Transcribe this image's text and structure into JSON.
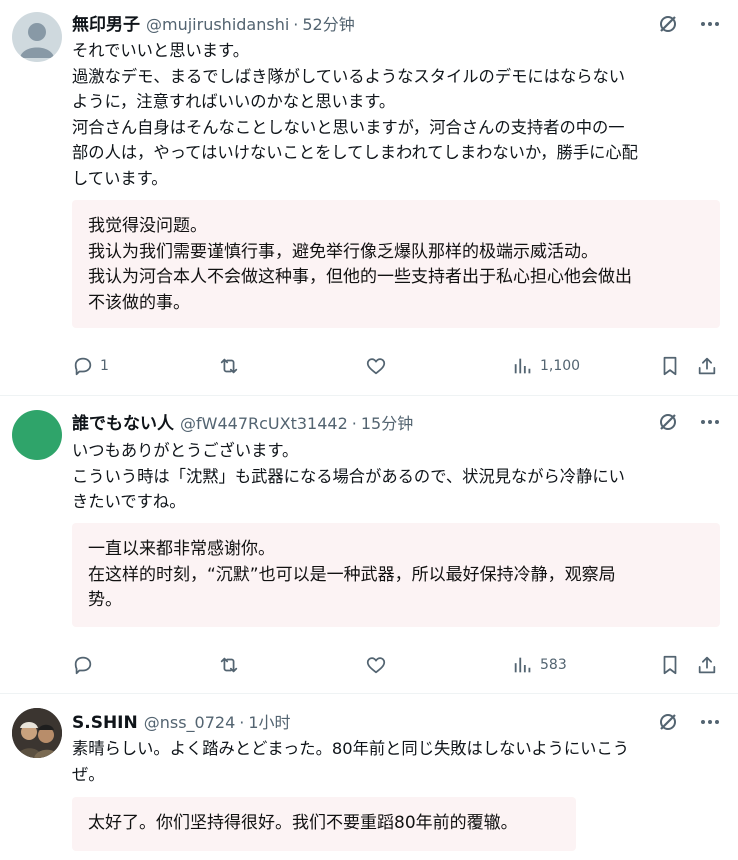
{
  "posts": [
    {
      "name": "無印男子",
      "handle": "@mujirushidanshi",
      "sep": "·",
      "time": "52分钟",
      "lines": [
        "それでいいと思います。",
        "過激なデモ、まるでしばき隊がしているようなスタイルのデモにはならない",
        "ように，注意すればいいのかなと思います。",
        "河合さん自身はそんなことしないと思いますが，河合さんの支持者の中の一",
        "部の人は，やってはいけないことをしてしまわれてしまわないか，勝手に心配",
        "しています。"
      ],
      "translation": [
        "我觉得没问题。",
        "我认为我们需要谨慎行事，避免举行像乏爆队那样的极端示威活动。",
        "我认为河合本人不会做这种事，但他的一些支持者出于私心担心他会做出",
        "不该做的事。"
      ],
      "replies": "1",
      "views": "1,100"
    },
    {
      "name": "誰でもない人",
      "handle": "@fW447RcUXt31442",
      "sep": "·",
      "time": "15分钟",
      "lines": [
        "いつもありがとうございます。",
        "こういう時は「沈黙」も武器になる場合があるので、状況見ながら冷静にい",
        "きたいですね。"
      ],
      "translation": [
        "一直以来都非常感谢你。",
        "在这样的时刻，“沉默”也可以是一种武器，所以最好保持冷静，观察局",
        "势。"
      ],
      "replies": "",
      "views": "583"
    },
    {
      "name": "S.SHIN",
      "handle": "@nss_0724",
      "sep": "·",
      "time": "1小时",
      "lines": [
        "素晴らしい。よく踏みとどまった。80年前と同じ失敗はしないようにいこう",
        "ぜ。"
      ],
      "translation": [
        "太好了。你们坚持得很好。我们不要重蹈80年前的覆辙。"
      ]
    }
  ],
  "icons": {
    "grok": "grok-icon",
    "more": "more-icon",
    "reply": "reply-icon",
    "repost": "repost-icon",
    "like": "like-icon",
    "views": "views-icon",
    "bookmark": "bookmark-icon",
    "share": "share-icon"
  },
  "colors": {
    "text": "#0f1419",
    "secondary": "#536471",
    "translation_bg": "#fcf3f4",
    "divider": "#eff3f4"
  }
}
